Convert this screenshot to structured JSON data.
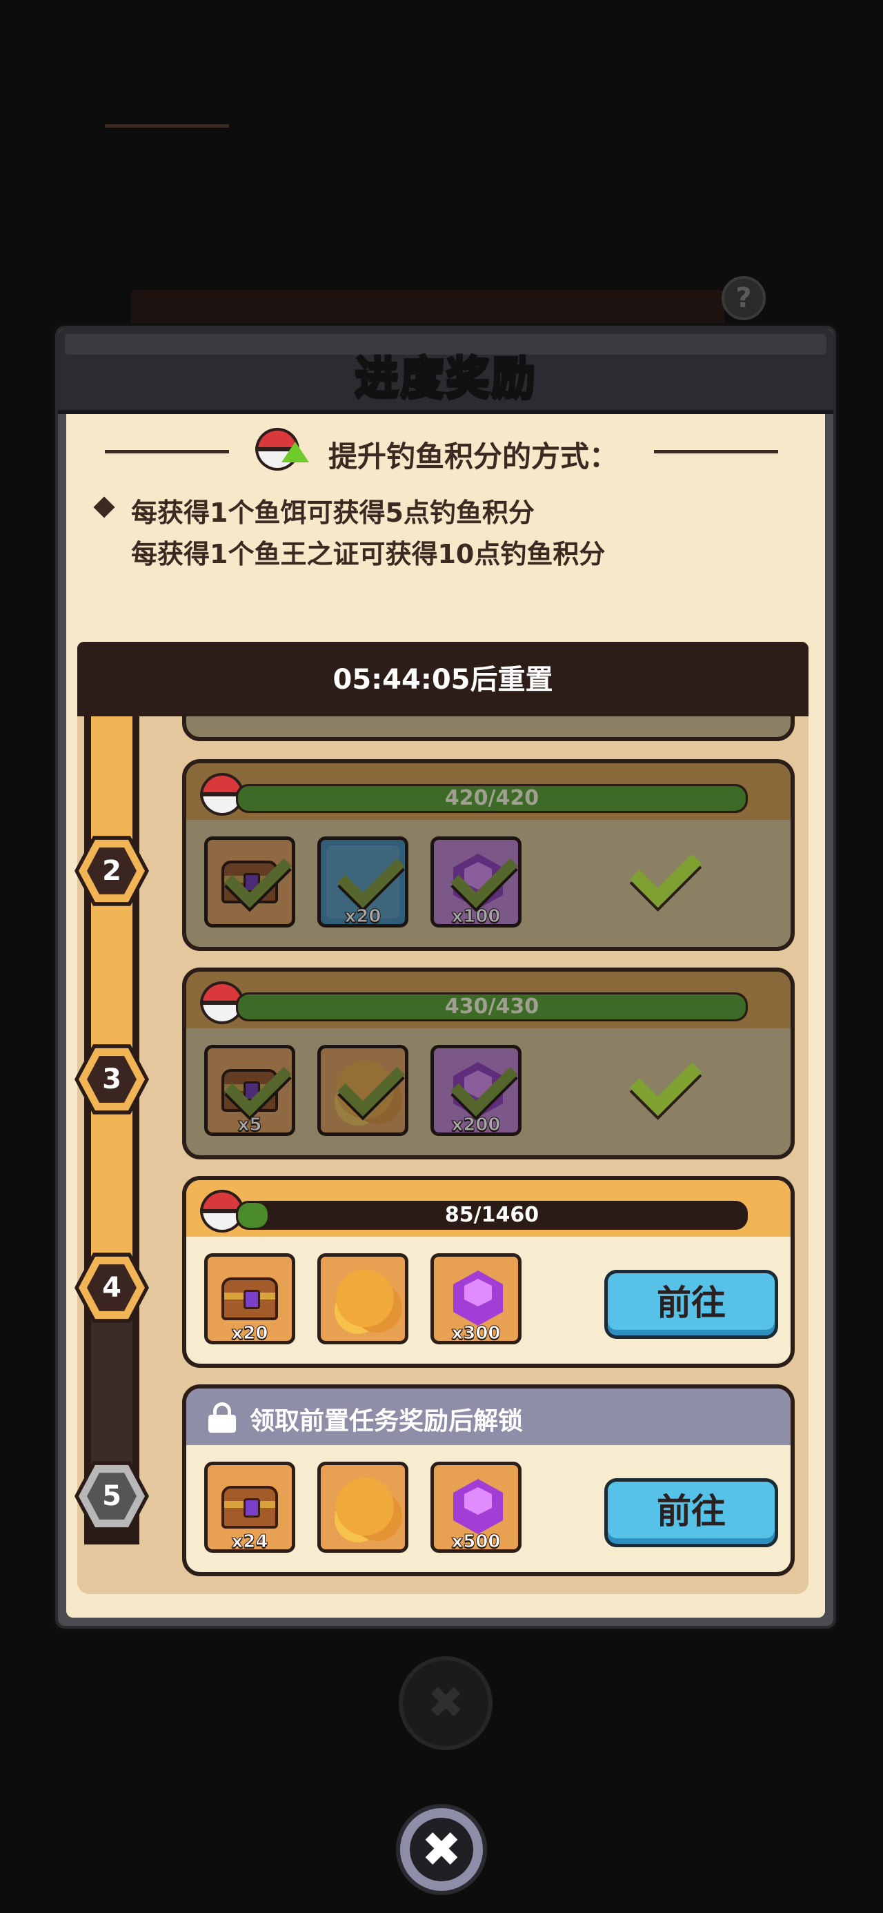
{
  "background": {
    "help_label": "?",
    "close_label": "✖"
  },
  "panel": {
    "title": "进度奖励",
    "info_title": "提升钓鱼积分的方式：",
    "rules": [
      "每获得1个鱼饵可获得5点钓鱼积分",
      "每获得1个鱼王之证可获得10点钓鱼积分"
    ],
    "reset_text": "05:44:05后重置"
  },
  "tiers": [
    {
      "level": "2",
      "state": "claimed",
      "progress_text": "420/420",
      "progress": 1.0,
      "rewards": [
        {
          "icon": "chest-icon",
          "qty": ""
        },
        {
          "icon": "blue-item-icon",
          "qty": "x20"
        },
        {
          "icon": "purple-gem-icon",
          "qty": "x100"
        }
      ]
    },
    {
      "level": "3",
      "state": "claimed",
      "progress_text": "430/430",
      "progress": 1.0,
      "rewards": [
        {
          "icon": "chest-icon",
          "qty": "x5"
        },
        {
          "icon": "golden-tree-icon",
          "qty": ""
        },
        {
          "icon": "purple-gem-icon",
          "qty": "x200"
        }
      ]
    },
    {
      "level": "4",
      "state": "active",
      "progress_text": "85/1460",
      "progress": 0.058,
      "go_label": "前往",
      "rewards": [
        {
          "icon": "purple-chest-icon",
          "qty": "x20"
        },
        {
          "icon": "golden-tree-icon",
          "qty": ""
        },
        {
          "icon": "purple-gem-icon",
          "qty": "x300"
        }
      ]
    },
    {
      "level": "5",
      "state": "locked",
      "locked_text": "领取前置任务奖励后解锁",
      "go_label": "前往",
      "rewards": [
        {
          "icon": "purple-chest-icon",
          "qty": "x24"
        },
        {
          "icon": "golden-tree-icon",
          "qty": ""
        },
        {
          "icon": "purple-gem-icon",
          "qty": "x500"
        }
      ]
    }
  ],
  "close_label": "✖",
  "colors": {
    "accent": "#f2b556",
    "go_button": "#56c2e8",
    "check": "#7fa132",
    "panel_bg": "#f6e8c9"
  }
}
